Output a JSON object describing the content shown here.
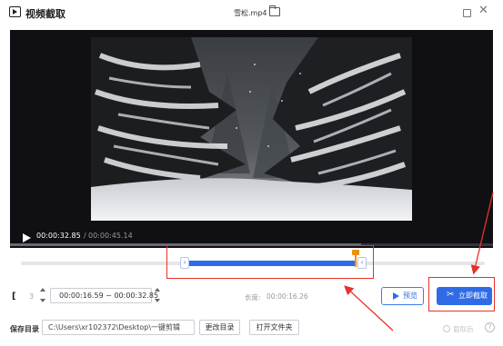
{
  "window": {
    "app_title": "视频截取",
    "file_name": "雪松.mp4",
    "icons": [
      "app-logo-icon",
      "folder-icon",
      "maximize-icon",
      "close-icon"
    ]
  },
  "player": {
    "current_time": "00:00:32.85",
    "separator": "/",
    "total_time": "00:00:45.14",
    "progress": 0.727
  },
  "trim": {
    "frame_label": "3",
    "range": "00:00:16.59 ~ 00:00:32.85",
    "duration_label": "长度:",
    "duration_value": "00:00:16.26",
    "preview_label": "预览",
    "cut_label": "立即截取",
    "handle_left_glyph": "›",
    "handle_right_glyph": "‹"
  },
  "save": {
    "label": "保存目录",
    "path": "C:\\Users\\xr102372\\Desktop\\一键剪辑",
    "change_dir_label": "更改目录",
    "open_folder_label": "打开文件夹",
    "cut_done_label": "截取后",
    "help_glyph": "?"
  },
  "colors": {
    "accent": "#2f6be6",
    "playhead": "#f0900f",
    "annotation": "#e8312a"
  }
}
